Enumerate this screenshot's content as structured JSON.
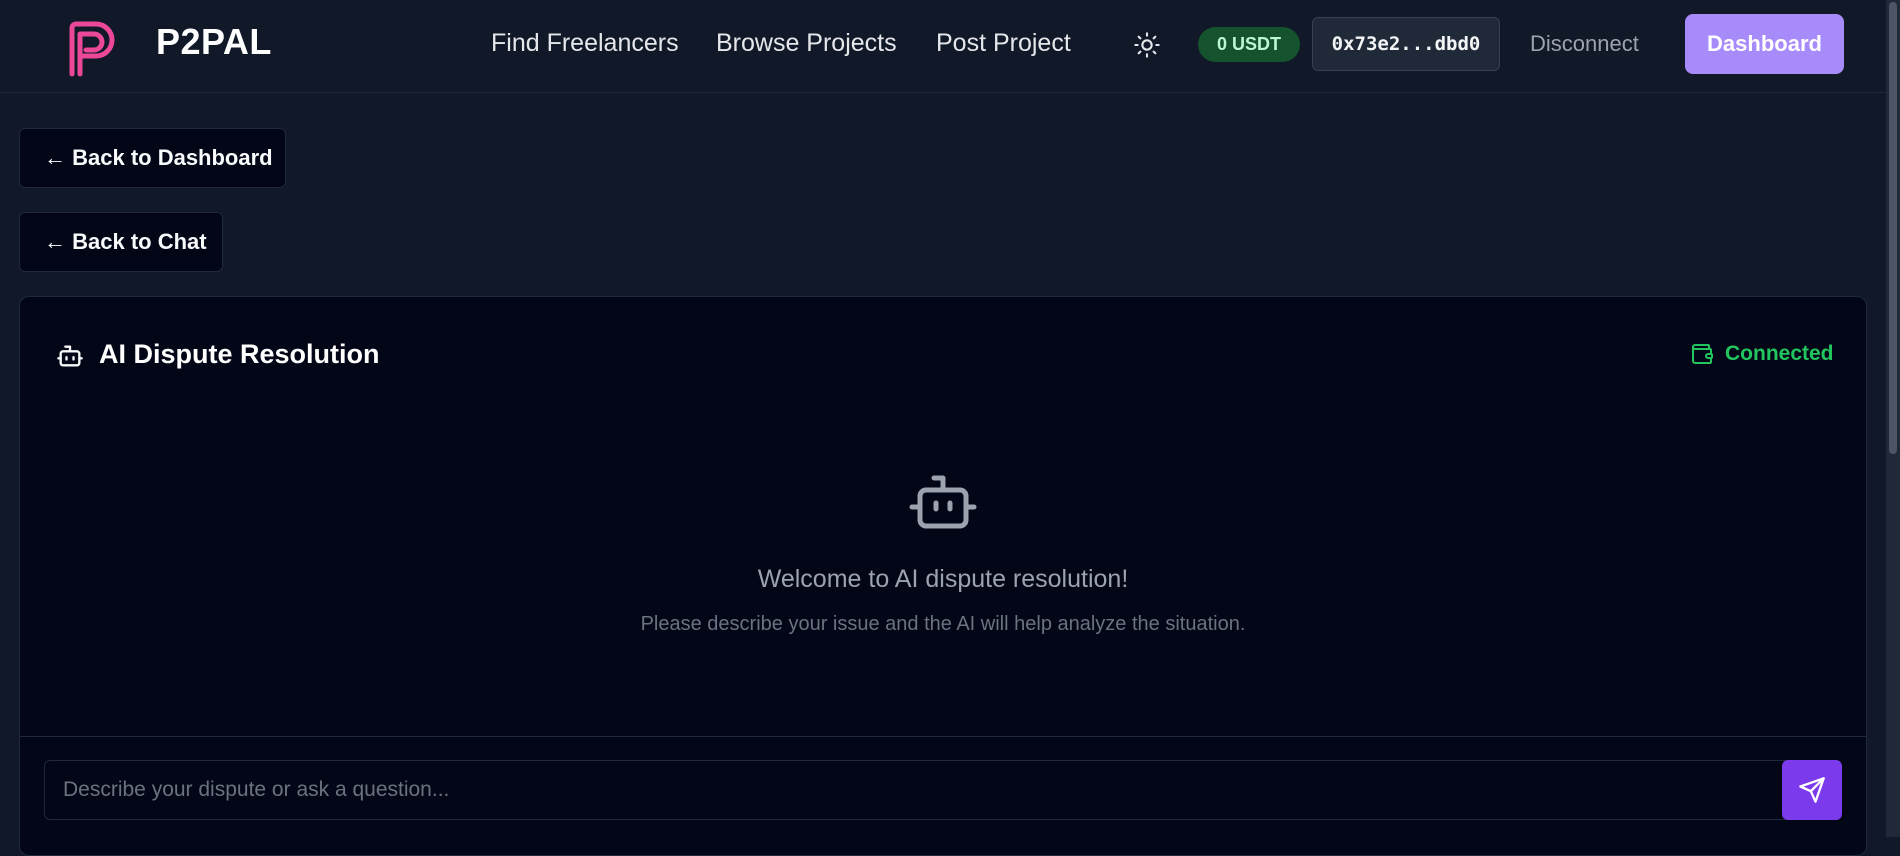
{
  "nav": {
    "brand": "P2PAL",
    "links": [
      "Find Freelancers",
      "Browse Projects",
      "Post Project"
    ],
    "theme_icon": "sun-icon",
    "balance": "0 USDT",
    "wallet_address": "0x73e2...dbd0",
    "disconnect_label": "Disconnect",
    "dashboard_label": "Dashboard"
  },
  "actions": {
    "back_to_dashboard": "← Back to Dashboard",
    "back_to_chat": "← Back to Chat"
  },
  "dispute": {
    "title": "AI Dispute Resolution",
    "status": "Connected",
    "welcome_title": "Welcome to AI dispute resolution!",
    "welcome_subtitle": "Please describe your issue and the AI will help analyze the situation.",
    "input_placeholder": "Describe your dispute or ask a question...",
    "send_icon": "send-icon"
  },
  "colors": {
    "background": "#111827",
    "accent": "#a78bfa",
    "send_button": "#7c3aed",
    "brand_logo": "#ec4899",
    "success": "#22c55e"
  }
}
